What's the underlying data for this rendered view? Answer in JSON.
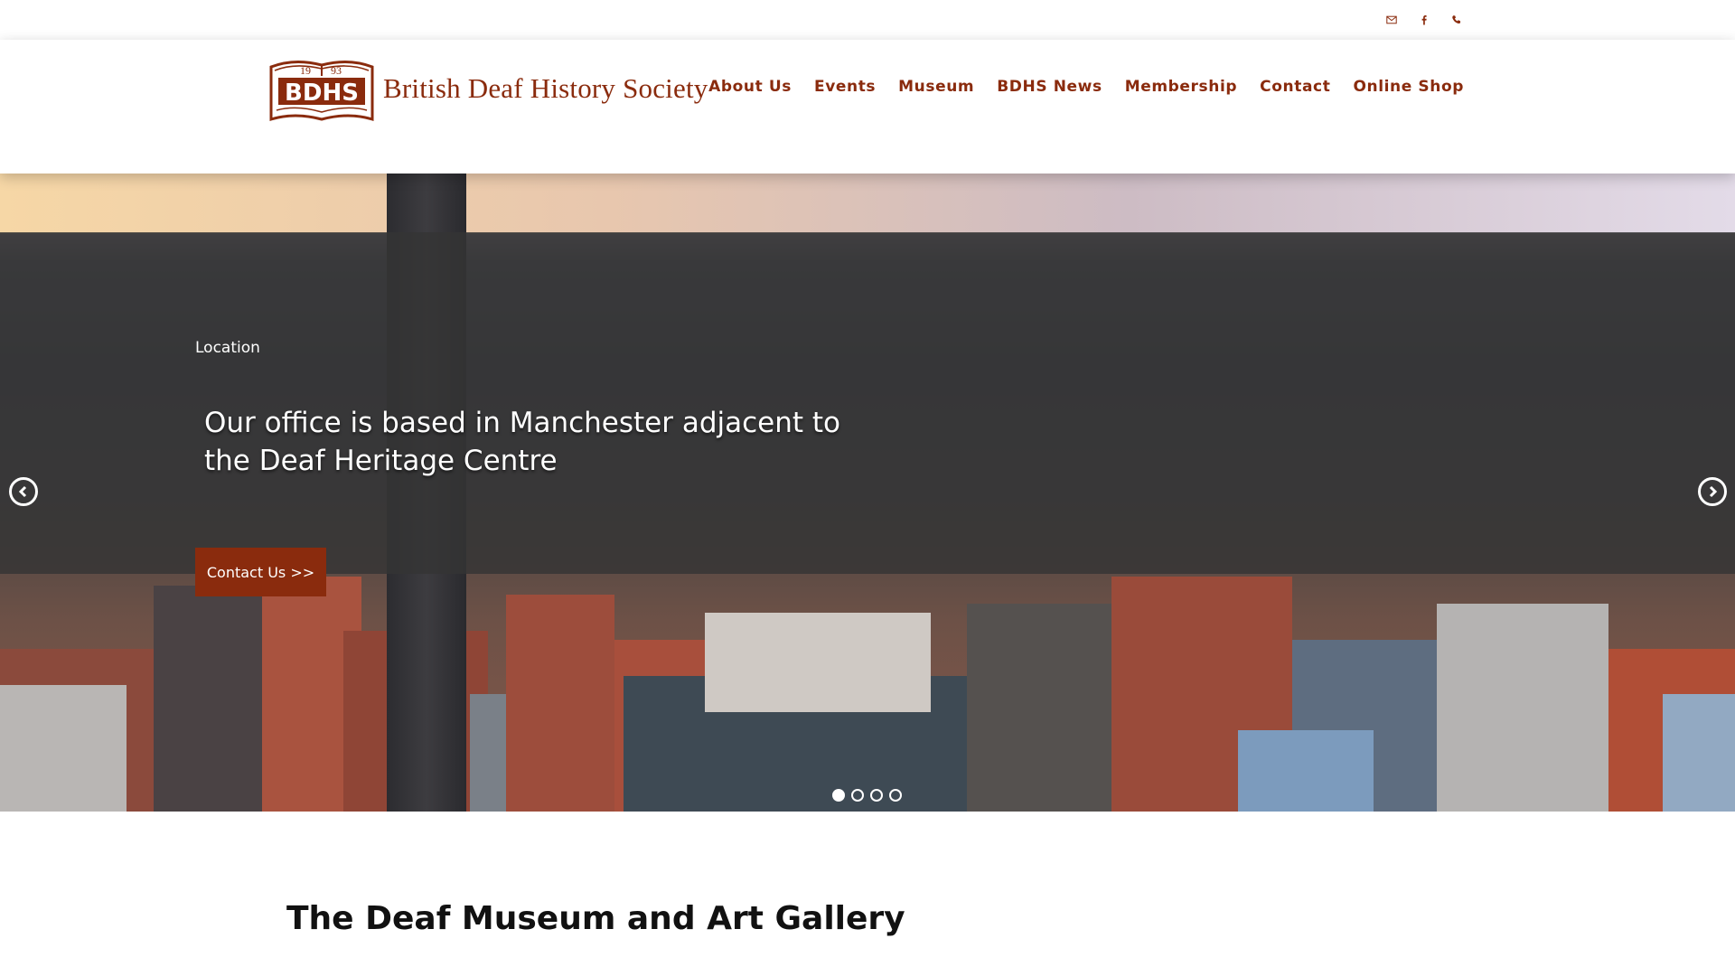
{
  "site": {
    "logo_year_left": "19",
    "logo_year_right": "93",
    "logo_mark": "BDHS",
    "logo_text": "British Deaf History Society",
    "brand_color": "#8a2b0d"
  },
  "topbar": {
    "icons": [
      "email-icon",
      "facebook-icon",
      "phone-icon"
    ]
  },
  "nav": {
    "items": [
      "About Us",
      "Events",
      "Museum",
      "BDHS News",
      "Membership",
      "Contact",
      "Online Shop"
    ]
  },
  "hero": {
    "tag": "Location",
    "heading": "Our office is based in Manchester adjacent to the Deaf Heritage Centre",
    "cta_label": "Contact Us >>",
    "slide_count": 4,
    "active_slide": 1
  },
  "section": {
    "title": "The Deaf Museum and Art Gallery"
  }
}
